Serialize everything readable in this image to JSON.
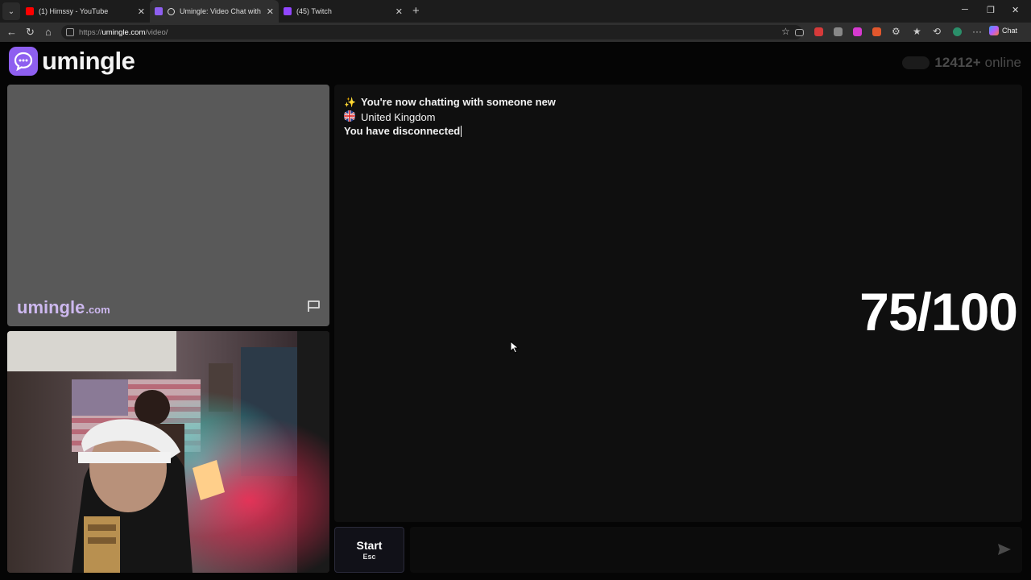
{
  "browser": {
    "tabs": [
      {
        "title": "(1) Himssy - YouTube",
        "favicon_color": "#ff0000",
        "active": false
      },
      {
        "title": "Umingle: Video Chat with Str",
        "favicon_color": "#8e5ff0",
        "active": true
      },
      {
        "title": "(45) Twitch",
        "favicon_color": "#9146ff",
        "active": false
      }
    ],
    "url_prefix": "https://",
    "url_host": "umingle.com",
    "url_path": "/video/",
    "chat_button_label": "Chat"
  },
  "header": {
    "logo_text": "umingle",
    "online_count": "12412+",
    "online_label": "online"
  },
  "stranger_video": {
    "watermark_main": "umingle",
    "watermark_suffix": ".com"
  },
  "chat": {
    "messages": [
      {
        "icon": "sparkles-icon",
        "glyph": "✨",
        "text": "You're now chatting with someone new"
      },
      {
        "icon": "uk-flag-icon",
        "glyph": "",
        "text": "United Kingdom"
      },
      {
        "icon": "",
        "glyph": "",
        "text": "You have disconnected"
      }
    ],
    "score_overlay": "75/100"
  },
  "controls": {
    "start_label": "Start",
    "start_shortcut": "Esc",
    "message_placeholder": ""
  },
  "colors": {
    "brand": "#8e5ff0",
    "background": "#050505",
    "panel": "#0f0f0f"
  }
}
